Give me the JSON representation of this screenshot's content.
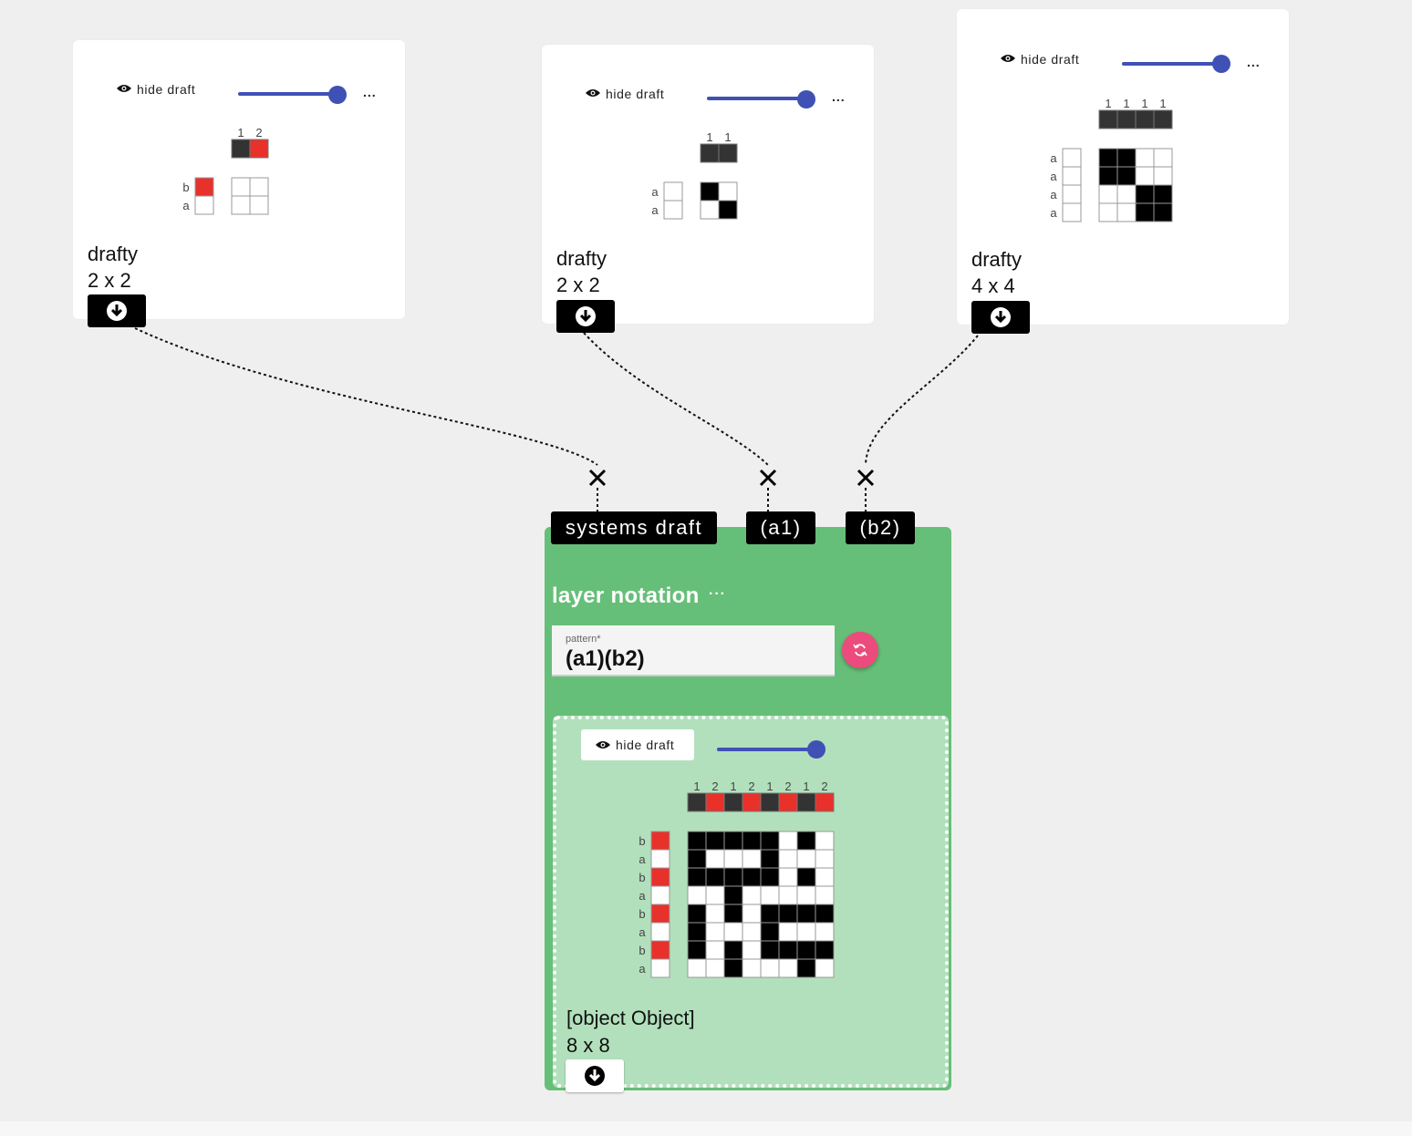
{
  "inputs": [
    {
      "hide_label": "hide draft",
      "more_label": "...",
      "name": "drafty",
      "size": "2 x 2",
      "warp_numbers": [
        "1",
        "2"
      ],
      "warp_colors": [
        "#333333",
        "#e8312a"
      ],
      "weft_letters": [
        "b",
        "a"
      ],
      "weft_colors": [
        "#e8312a",
        "#ffffff"
      ],
      "cells": [
        [
          0,
          0
        ],
        [
          0,
          0
        ]
      ]
    },
    {
      "hide_label": "hide draft",
      "more_label": "...",
      "name": "drafty",
      "size": "2 x 2",
      "warp_numbers": [
        "1",
        "1"
      ],
      "warp_colors": [
        "#333333",
        "#333333"
      ],
      "weft_letters": [
        "a",
        "a"
      ],
      "weft_colors": [
        "#ffffff",
        "#ffffff"
      ],
      "cells": [
        [
          1,
          0
        ],
        [
          0,
          1
        ]
      ]
    },
    {
      "hide_label": "hide draft",
      "more_label": "...",
      "name": "drafty",
      "size": "4 x 4",
      "warp_numbers": [
        "1",
        "1",
        "1",
        "1"
      ],
      "warp_colors": [
        "#333333",
        "#333333",
        "#333333",
        "#333333"
      ],
      "weft_letters": [
        "a",
        "a",
        "a",
        "a"
      ],
      "weft_colors": [
        "#ffffff",
        "#ffffff",
        "#ffffff",
        "#ffffff"
      ],
      "cells": [
        [
          1,
          1,
          0,
          0
        ],
        [
          1,
          1,
          0,
          0
        ],
        [
          0,
          0,
          1,
          1
        ],
        [
          0,
          0,
          1,
          1
        ]
      ]
    }
  ],
  "ports": [
    "systems draft",
    "(a1)",
    "(b2)"
  ],
  "operation": {
    "title": "layer notation",
    "more_label": "···",
    "pattern_label": "pattern*",
    "pattern_value": "(a1)(b2)",
    "output": {
      "hide_label": "hide draft",
      "name": "[object Object]",
      "size": "8 x 8",
      "warp_numbers": [
        "1",
        "2",
        "1",
        "2",
        "1",
        "2",
        "1",
        "2"
      ],
      "warp_colors": [
        "#333333",
        "#e8312a",
        "#333333",
        "#e8312a",
        "#333333",
        "#e8312a",
        "#333333",
        "#e8312a"
      ],
      "weft_letters": [
        "b",
        "a",
        "b",
        "a",
        "b",
        "a",
        "b",
        "a"
      ],
      "weft_colors": [
        "#e8312a",
        "#ffffff",
        "#e8312a",
        "#ffffff",
        "#e8312a",
        "#ffffff",
        "#e8312a",
        "#ffffff"
      ],
      "cells": [
        [
          1,
          1,
          1,
          1,
          1,
          0,
          1,
          0
        ],
        [
          1,
          0,
          0,
          0,
          1,
          0,
          0,
          0
        ],
        [
          1,
          1,
          1,
          1,
          1,
          0,
          1,
          0
        ],
        [
          0,
          0,
          1,
          0,
          0,
          0,
          0,
          0
        ],
        [
          1,
          0,
          1,
          0,
          1,
          1,
          1,
          1
        ],
        [
          1,
          0,
          0,
          0,
          1,
          0,
          0,
          0
        ],
        [
          1,
          0,
          1,
          0,
          1,
          1,
          1,
          1
        ],
        [
          0,
          0,
          1,
          0,
          0,
          0,
          1,
          0
        ]
      ]
    }
  },
  "colors": {
    "operation_bg": "#66bf78",
    "result_bg": "#b2e0bc",
    "slider": "#3f51b5",
    "refresh": "#ec4b7d",
    "warp_dark": "#333333",
    "accent_red": "#e8312a"
  },
  "icons": [
    "eye-icon",
    "download-icon",
    "refresh-icon",
    "close-x-icon",
    "more-icon"
  ]
}
